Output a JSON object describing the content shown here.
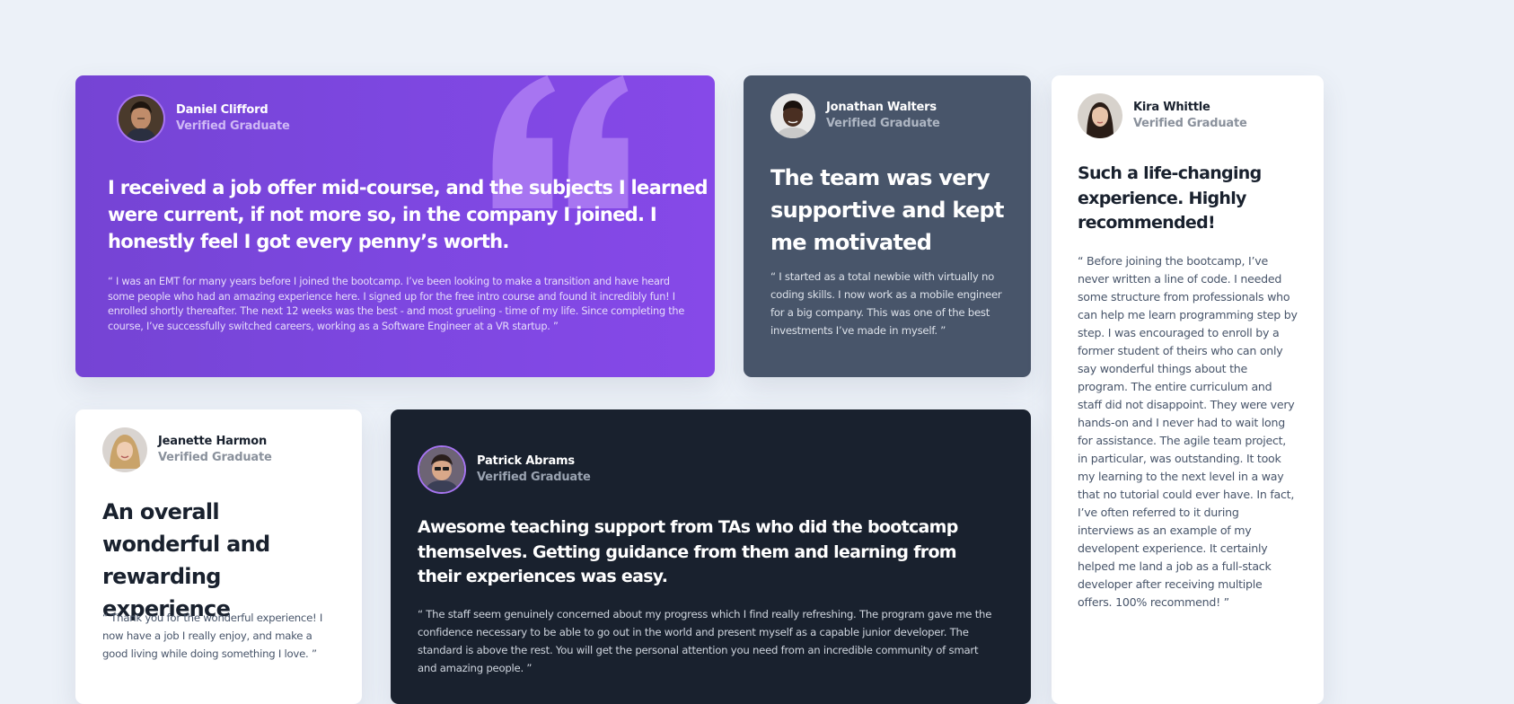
{
  "colors": {
    "page_bg": "#ecf1f8",
    "purple": "#7d47e0",
    "slate": "#48556a",
    "dark": "#19212e",
    "white": "#ffffff",
    "quote_mark": "#a775f1"
  },
  "testimonials": [
    {
      "name": "Daniel Clifford",
      "role": "Verified Graduate",
      "headline": "I received a job offer mid-course, and the subjects I learned were current, if not more so, in the company I joined. I honestly feel I got every penny’s worth.",
      "quote": "“ I was an EMT for many years before I joined the bootcamp. I’ve been looking to make a transition and have heard some people who had an amazing experience here. I signed up for the free intro course and found it incredibly fun! I enrolled shortly thereafter. The next 12 weeks was the best - and most grueling - time of my life. Since completing the course, I’ve successfully switched careers, working as a Software Engineer at a VR startup. ”",
      "avatar_icon": "avatar-daniel-clifford",
      "decoration_icon": "quotation-mark-icon"
    },
    {
      "name": "Jonathan Walters",
      "role": "Verified Graduate",
      "headline": "The team was very supportive and kept me motivated",
      "quote": "“ I started as a total newbie with virtually no coding skills. I now work as a mobile engineer for a big company. This was one of the best investments I’ve made in myself. ”",
      "avatar_icon": "avatar-jonathan-walters"
    },
    {
      "name": "Kira Whittle",
      "role": "Verified Graduate",
      "headline": "Such a life-changing experience. Highly recommended!",
      "quote": "“ Before joining the bootcamp, I’ve never written a line of code. I needed some structure from professionals who can help me learn programming step by step. I was encouraged to enroll by a former student of theirs who can only say wonderful things about the program. The entire curriculum and staff did not disappoint. They were very hands-on and I never had to wait long for assistance. The agile team project, in particular, was outstanding. It took my learning to the next level in a way that no tutorial could ever have. In fact, I’ve often referred to it during interviews as an example of my developent experience. It certainly helped me land a job as a full-stack developer after receiving multiple offers. 100% recommend! ”",
      "avatar_icon": "avatar-kira-whittle"
    },
    {
      "name": "Jeanette Harmon",
      "role": "Verified Graduate",
      "headline": "An overall wonderful and rewarding experience",
      "quote": "“ Thank you for the wonderful experience! I now have a job I really enjoy, and make a good living while doing something I love. ”",
      "avatar_icon": "avatar-jeanette-harmon"
    },
    {
      "name": "Patrick Abrams",
      "role": "Verified Graduate",
      "headline": "Awesome teaching support from TAs who did the bootcamp themselves. Getting guidance from them and learning from their experiences was easy.",
      "quote": "“ The staff seem genuinely concerned about my progress which I find really refreshing. The program gave me the confidence necessary to be able to go out in the world and present myself as a capable junior developer. The standard is above the rest. You will get the personal attention you need from an incredible community of smart and amazing people. ”",
      "avatar_icon": "avatar-patrick-abrams"
    }
  ]
}
